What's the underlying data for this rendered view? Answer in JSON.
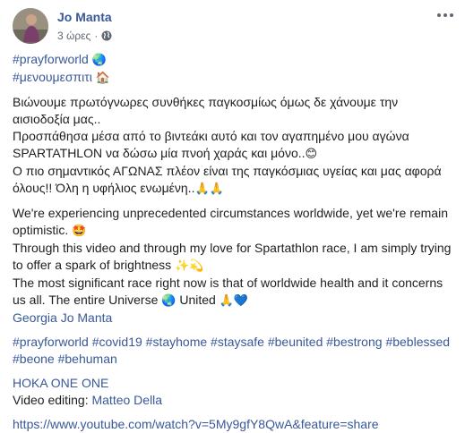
{
  "post": {
    "author": "Jo Manta",
    "time": "3 ώρες",
    "separator": "·",
    "privacy_icon": "globe-icon",
    "more_icon": "more-dots-icon"
  },
  "lines": {
    "tag1": "#prayforworld",
    "tag1_emoji": "🌏",
    "tag2": "#μενουμεσπιτι",
    "tag2_emoji": "🏠",
    "gr1": "Βιώνουμε πρωτόγνωρες συνθήκες παγκοσμίως όμως δε χάνουμε την αισιοδοξία μας..",
    "gr2": "Προσπάθησα μέσα από το βιντεάκι αυτό και τον αγαπημένο μου αγώνα SPARTATHLON να δώσω μία πνοή χαράς και μόνο..",
    "gr2_emoji": "😊",
    "gr3": "Ο πιο σημαντικός ΑΓΩΝΑΣ πλέον είναι της παγκόσμιας υγείας και μας αφορά όλους!! Όλη η υφήλιος ενωμένη..",
    "gr3_emoji": "🙏🙏",
    "en1": "We're experiencing unprecedented circumstances worldwide, yet we're remain optimistic.",
    "en1_emoji": "🤩",
    "en2": "Through this video and through my love for Spartathlon race, I am simply trying to offer a spark of brightness",
    "en2_emoji": "✨💫",
    "en3": "The most significant race right now is that of worldwide health and it concerns us all. The entire Universe",
    "en3_emoji1": "🌏",
    "en3_word": "United",
    "en3_emoji2": "🙏💙",
    "mention": "Georgia Jo Manta",
    "hashtags": [
      "#prayforworld",
      "#covid19",
      "#stayhome",
      "#staysafe",
      "#beunited",
      "#bestrong",
      "#beblessed",
      "#beone",
      "#behuman"
    ],
    "brand": "HOKA ONE ONE",
    "editing_label": "Video editing:",
    "editor": "Matteo Della",
    "url": "https://www.youtube.com/watch?v=5My9gfY8QwA&feature=share"
  },
  "colors": {
    "link": "#385898",
    "text": "#1c1e21",
    "meta": "#606770"
  }
}
